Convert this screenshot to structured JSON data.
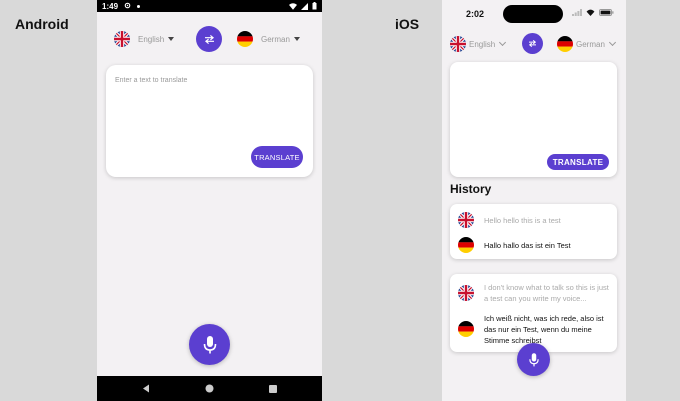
{
  "labels": {
    "android": "Android",
    "ios": "iOS"
  },
  "android": {
    "status_time": "1:49",
    "source_lang": "English",
    "target_lang": "German",
    "input_placeholder": "Enter a text to translate",
    "translate_label": "TRANSLATE"
  },
  "ios": {
    "status_time": "2:02",
    "source_lang": "English",
    "target_lang": "German",
    "translate_label": "TRANSLATE",
    "history_title": "History",
    "history": [
      {
        "source": "Hello hello this is a test",
        "target": "Hallo hallo das ist ein Test"
      },
      {
        "source": "I don't know what to talk so this is just a test can you write my voice...",
        "target": "Ich weiß nicht, was ich rede, also ist das nur ein Test, wenn du meine Stimme schreibst"
      }
    ]
  },
  "colors": {
    "accent": "#5b3fd0",
    "background": "#f3f1f3",
    "frame": "#d9d9d9"
  },
  "icons": {
    "swap": "swap-arrows-icon",
    "mic": "microphone-icon",
    "uk": "uk-flag-icon",
    "de": "germany-flag-icon"
  }
}
